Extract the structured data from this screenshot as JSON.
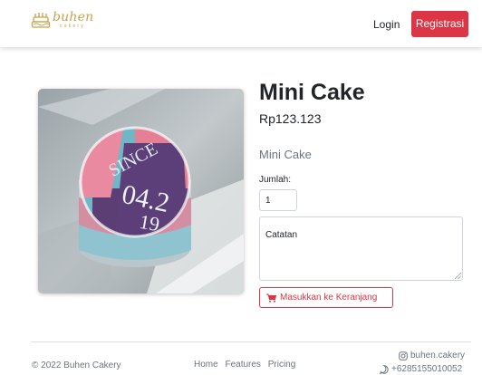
{
  "navbar": {
    "brand_name": "buhen",
    "brand_sub": "cakery",
    "login_label": "Login",
    "register_label": "Registrasi"
  },
  "product": {
    "title": "Mini Cake",
    "price": "Rp123.123",
    "description": "Mini Cake",
    "quantity_label": "Jumlah:",
    "quantity_value": "1",
    "notes_placeholder": "Catatan",
    "add_to_cart_label": "Masukkan ke Keranjang",
    "image_text_top": "SINCE",
    "image_text_mid": "04.2",
    "image_text_bottom": "19"
  },
  "footer": {
    "copyright": "© 2022 Buhen Cakery",
    "nav": [
      "Home",
      "Features",
      "Pricing"
    ],
    "instagram": "buhen.cakery",
    "whatsapp": "+6285155010052"
  },
  "colors": {
    "accent": "#dc3545",
    "brand": "#c9a24a"
  }
}
